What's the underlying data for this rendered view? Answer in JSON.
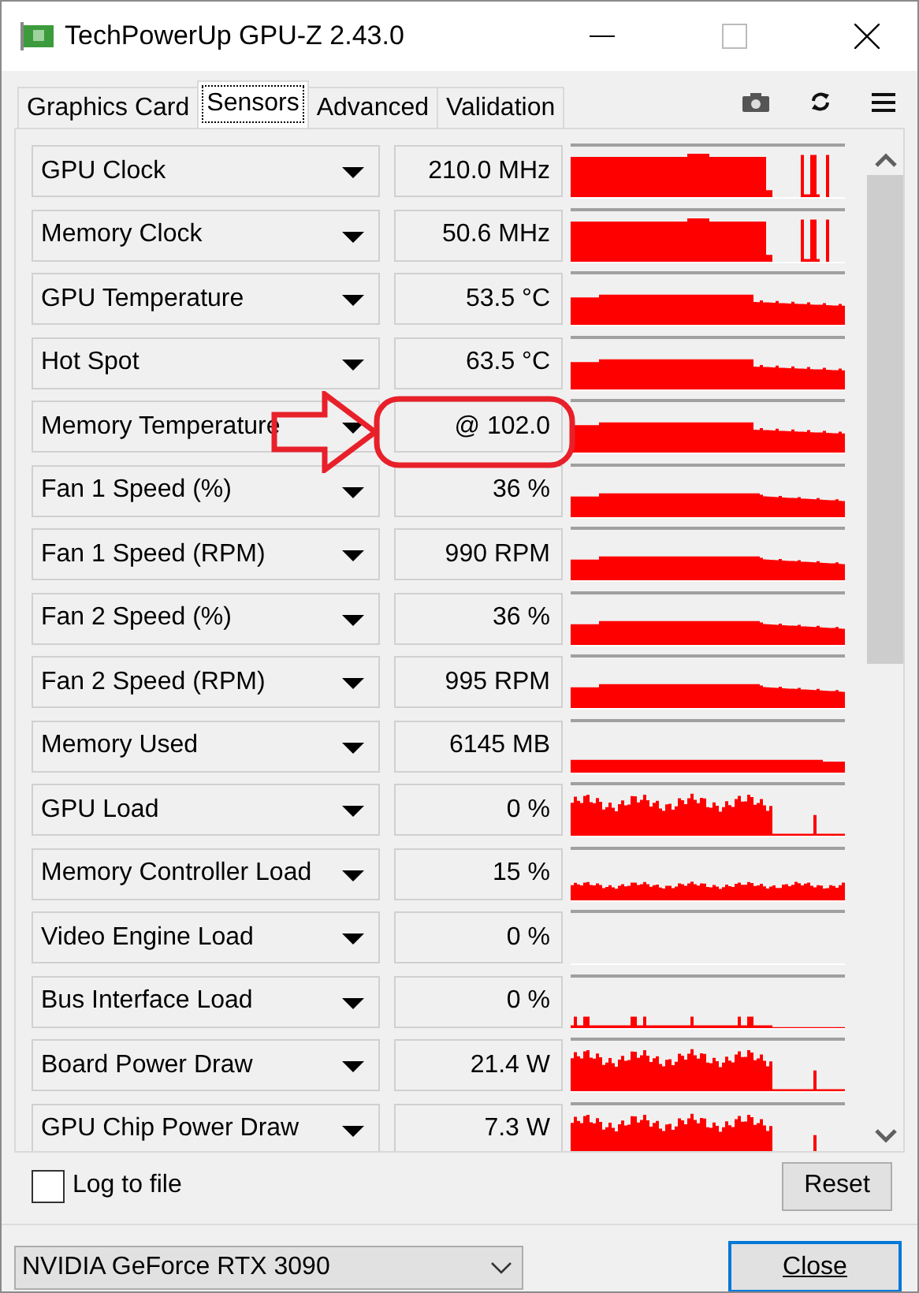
{
  "window": {
    "title": "TechPowerUp GPU-Z 2.43.0"
  },
  "tabs": [
    {
      "label": "Graphics Card",
      "selected": false
    },
    {
      "label": "Sensors",
      "selected": true
    },
    {
      "label": "Advanced",
      "selected": false
    },
    {
      "label": "Validation",
      "selected": false
    }
  ],
  "sensors": [
    {
      "name": "GPU Clock",
      "value": "210.0 MHz",
      "kind": "spiky"
    },
    {
      "name": "Memory Clock",
      "value": "50.6 MHz",
      "kind": "spiky"
    },
    {
      "name": "GPU Temperature",
      "value": "53.5 °C",
      "kind": "plateau"
    },
    {
      "name": "Hot Spot",
      "value": "63.5 °C",
      "kind": "plateau"
    },
    {
      "name": "Memory Temperature",
      "value": "@ 102.0",
      "kind": "plateau"
    },
    {
      "name": "Fan 1 Speed (%)",
      "value": "36 %",
      "kind": "fan"
    },
    {
      "name": "Fan 1 Speed (RPM)",
      "value": "990 RPM",
      "kind": "fan"
    },
    {
      "name": "Fan 2 Speed (%)",
      "value": "36 %",
      "kind": "fan"
    },
    {
      "name": "Fan 2 Speed (RPM)",
      "value": "995 RPM",
      "kind": "fan"
    },
    {
      "name": "Memory Used",
      "value": "6145 MB",
      "kind": "low"
    },
    {
      "name": "GPU Load",
      "value": "0 %",
      "kind": "noisy"
    },
    {
      "name": "Memory Controller Load",
      "value": "15 %",
      "kind": "midnoisy"
    },
    {
      "name": "Video Engine Load",
      "value": "0 %",
      "kind": "empty"
    },
    {
      "name": "Bus Interface Load",
      "value": "0 %",
      "kind": "sparse"
    },
    {
      "name": "Board Power Draw",
      "value": "21.4 W",
      "kind": "noisy"
    },
    {
      "name": "GPU Chip Power Draw",
      "value": "7.3 W",
      "kind": "noisy"
    }
  ],
  "log_to_file": {
    "label": "Log to file",
    "checked": false
  },
  "reset_button": "Reset",
  "gpu_select": {
    "value": "NVIDIA GeForce RTX 3090"
  },
  "close_button": "Close"
}
